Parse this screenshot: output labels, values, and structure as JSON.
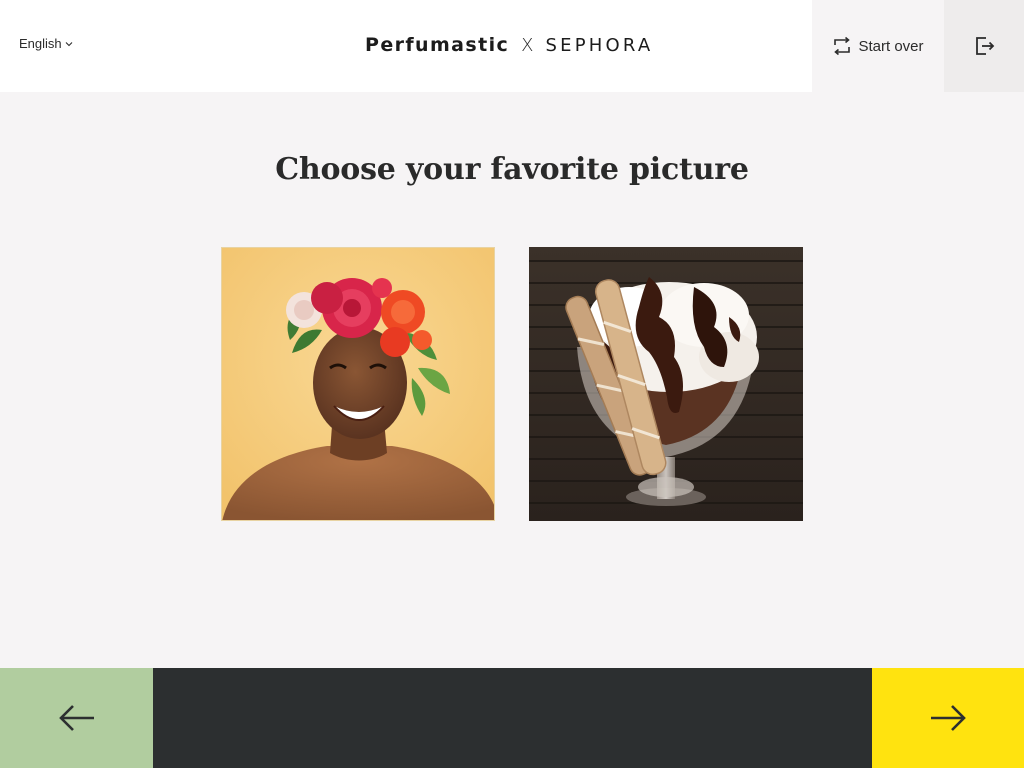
{
  "header": {
    "language": {
      "label": "English",
      "icon": "chevron-down-icon"
    },
    "brand": {
      "left": "Perfumastic",
      "separator": "X",
      "right": "SEPHORA"
    },
    "start_over": {
      "label": "Start over",
      "icon": "repeat-icon"
    },
    "logout": {
      "icon": "logout-icon"
    }
  },
  "main": {
    "title": "Choose your favorite picture",
    "pictures": [
      {
        "subject": "woman-flower-crown"
      },
      {
        "subject": "ice-cream-sundae"
      }
    ]
  },
  "footer": {
    "back": {
      "icon": "arrow-left-icon"
    },
    "next": {
      "icon": "arrow-right-icon"
    }
  },
  "colors": {
    "background": "#f6f4f5",
    "header": "#ffffff",
    "footer": "#2c2f30",
    "back_button": "#b1cd9f",
    "next_button": "#ffe30f",
    "start_over_bg": "#f6f4f5",
    "logout_bg": "#eeecec"
  }
}
